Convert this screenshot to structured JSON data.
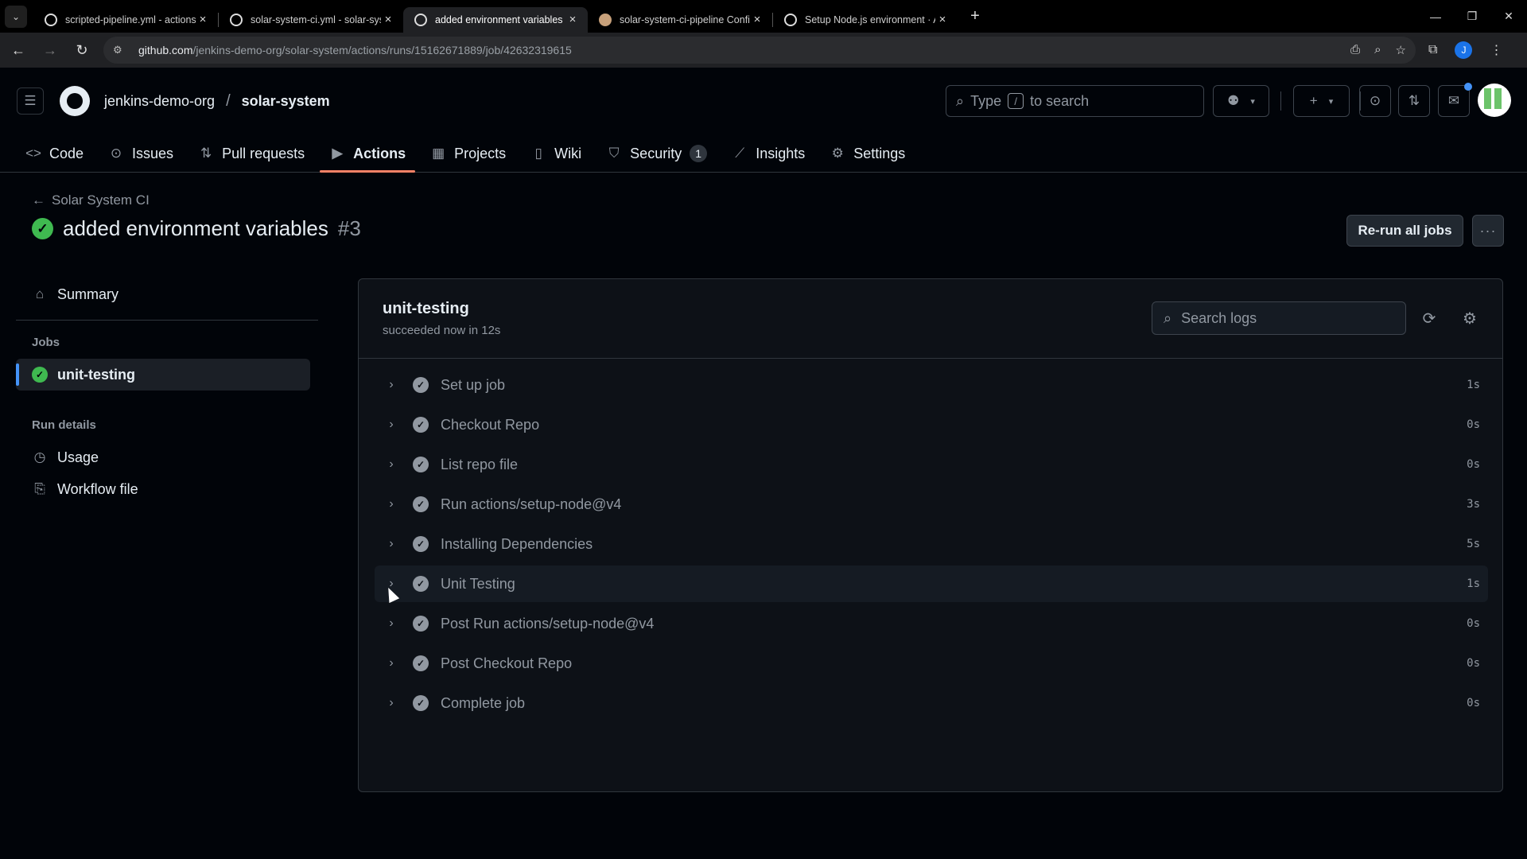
{
  "browser": {
    "tabs": [
      {
        "title": "scripted-pipeline.yml - actions-",
        "active": false,
        "favicon": "github-icon"
      },
      {
        "title": "solar-system-ci.yml - solar-syst",
        "active": false,
        "favicon": "github-icon"
      },
      {
        "title": "added environment variables · j",
        "active": true,
        "favicon": "github-icon"
      },
      {
        "title": "solar-system-ci-pipeline Config",
        "active": false,
        "favicon": "jenkins-icon"
      },
      {
        "title": "Setup Node.js environment · Ac",
        "active": false,
        "favicon": "github-icon"
      }
    ],
    "url_host": "github.com",
    "url_path": "/jenkins-demo-org/solar-system/actions/runs/15162671889/job/42632319615",
    "profile_initial": "J"
  },
  "header": {
    "org": "jenkins-demo-org",
    "repo": "solar-system",
    "search_prefix": "Type",
    "search_key": "/",
    "search_suffix": "to search"
  },
  "repo_nav": {
    "items": [
      {
        "label": "Code",
        "icon": "code-icon"
      },
      {
        "label": "Issues",
        "icon": "issue-icon"
      },
      {
        "label": "Pull requests",
        "icon": "pull-request-icon"
      },
      {
        "label": "Actions",
        "icon": "play-icon",
        "active": true
      },
      {
        "label": "Projects",
        "icon": "table-icon"
      },
      {
        "label": "Wiki",
        "icon": "book-icon"
      },
      {
        "label": "Security",
        "icon": "shield-icon",
        "count": "1"
      },
      {
        "label": "Insights",
        "icon": "graph-icon"
      },
      {
        "label": "Settings",
        "icon": "gear-icon"
      }
    ]
  },
  "run": {
    "back_label": "Solar System CI",
    "title": "added environment variables",
    "number": "#3",
    "rerun_label": "Re-run all jobs"
  },
  "sidebar": {
    "summary": "Summary",
    "jobs_heading": "Jobs",
    "job": "unit-testing",
    "run_details_heading": "Run details",
    "usage": "Usage",
    "workflow_file": "Workflow file"
  },
  "job": {
    "name": "unit-testing",
    "status": "succeeded now in 12s",
    "search_placeholder": "Search logs",
    "steps": [
      {
        "label": "Set up job",
        "duration": "1s"
      },
      {
        "label": "Checkout Repo",
        "duration": "0s"
      },
      {
        "label": "List repo file",
        "duration": "0s"
      },
      {
        "label": "Run actions/setup-node@v4",
        "duration": "3s"
      },
      {
        "label": "Installing Dependencies",
        "duration": "5s"
      },
      {
        "label": "Unit Testing",
        "duration": "1s"
      },
      {
        "label": "Post Run actions/setup-node@v4",
        "duration": "0s"
      },
      {
        "label": "Post Checkout Repo",
        "duration": "0s"
      },
      {
        "label": "Complete job",
        "duration": "0s"
      }
    ]
  },
  "colors": {
    "success": "#3fb950",
    "accent_underline": "#f78166",
    "link_blue": "#4493f8",
    "background": "#010409"
  }
}
